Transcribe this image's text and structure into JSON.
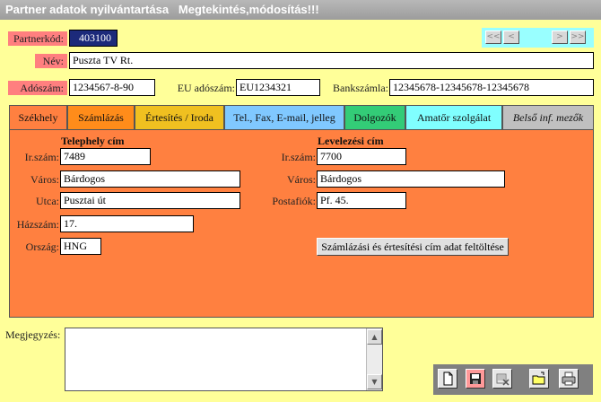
{
  "window": {
    "title": "Partner adatok nyilvántartása   Megtekintés,módosítás!!!"
  },
  "form": {
    "partnerkod": {
      "label": "Partnerkód:",
      "value": "403100"
    },
    "nev": {
      "label": "Név:",
      "value": "Puszta TV Rt."
    },
    "adoszam": {
      "label": "Adószám:",
      "value": "1234567-8-90"
    },
    "eu_adoszam": {
      "label": "EU adószám:",
      "value": "EU1234321"
    },
    "bankszamla": {
      "label": "Bankszámla:",
      "value": "12345678-12345678-12345678"
    }
  },
  "nav": {
    "first": "<<",
    "prev": "<",
    "next": ">",
    "last": ">>"
  },
  "tabs": [
    {
      "label": "Székhely",
      "color": "#ff8040"
    },
    {
      "label": "Számlázás",
      "color": "#ff8c1a"
    },
    {
      "label": "Értesítés / Iroda",
      "color": "#f0c020"
    },
    {
      "label": "Tel., Fax, E-mail, jelleg",
      "color": "#80c8ff"
    },
    {
      "label": "Dolgozók",
      "color": "#33cc77"
    },
    {
      "label": "Amatőr szolgálat",
      "color": "#80ffff"
    },
    {
      "label": "Belső inf. mezők",
      "color": "#c0c0c0"
    }
  ],
  "telephely": {
    "title": "Telephely cím",
    "irszam": {
      "label": "Ir.szám:",
      "value": "7489"
    },
    "varos": {
      "label": "Város:",
      "value": "Bárdogos"
    },
    "utca": {
      "label": "Utca:",
      "value": "Pusztai út"
    },
    "hazszam": {
      "label": "Házszám:",
      "value": "17."
    },
    "orszag": {
      "label": "Ország:",
      "value": "HNG"
    }
  },
  "levelezesi": {
    "title": "Levelezési cím",
    "irszam": {
      "label": "Ir.szám:",
      "value": "7700"
    },
    "varos": {
      "label": "Város:",
      "value": "Bárdogos"
    },
    "postafiok": {
      "label": "Postafiók:",
      "value": "Pf. 45."
    }
  },
  "fill_button": {
    "label": "Számlázási és értesítési cím adat feltöltése"
  },
  "megjegyzes": {
    "label": "Megjegyzés:",
    "value": ""
  },
  "toolbar": {
    "icons": [
      "new-document-icon",
      "save-icon",
      "delete-icon",
      "open-folder-icon",
      "print-icon"
    ]
  }
}
